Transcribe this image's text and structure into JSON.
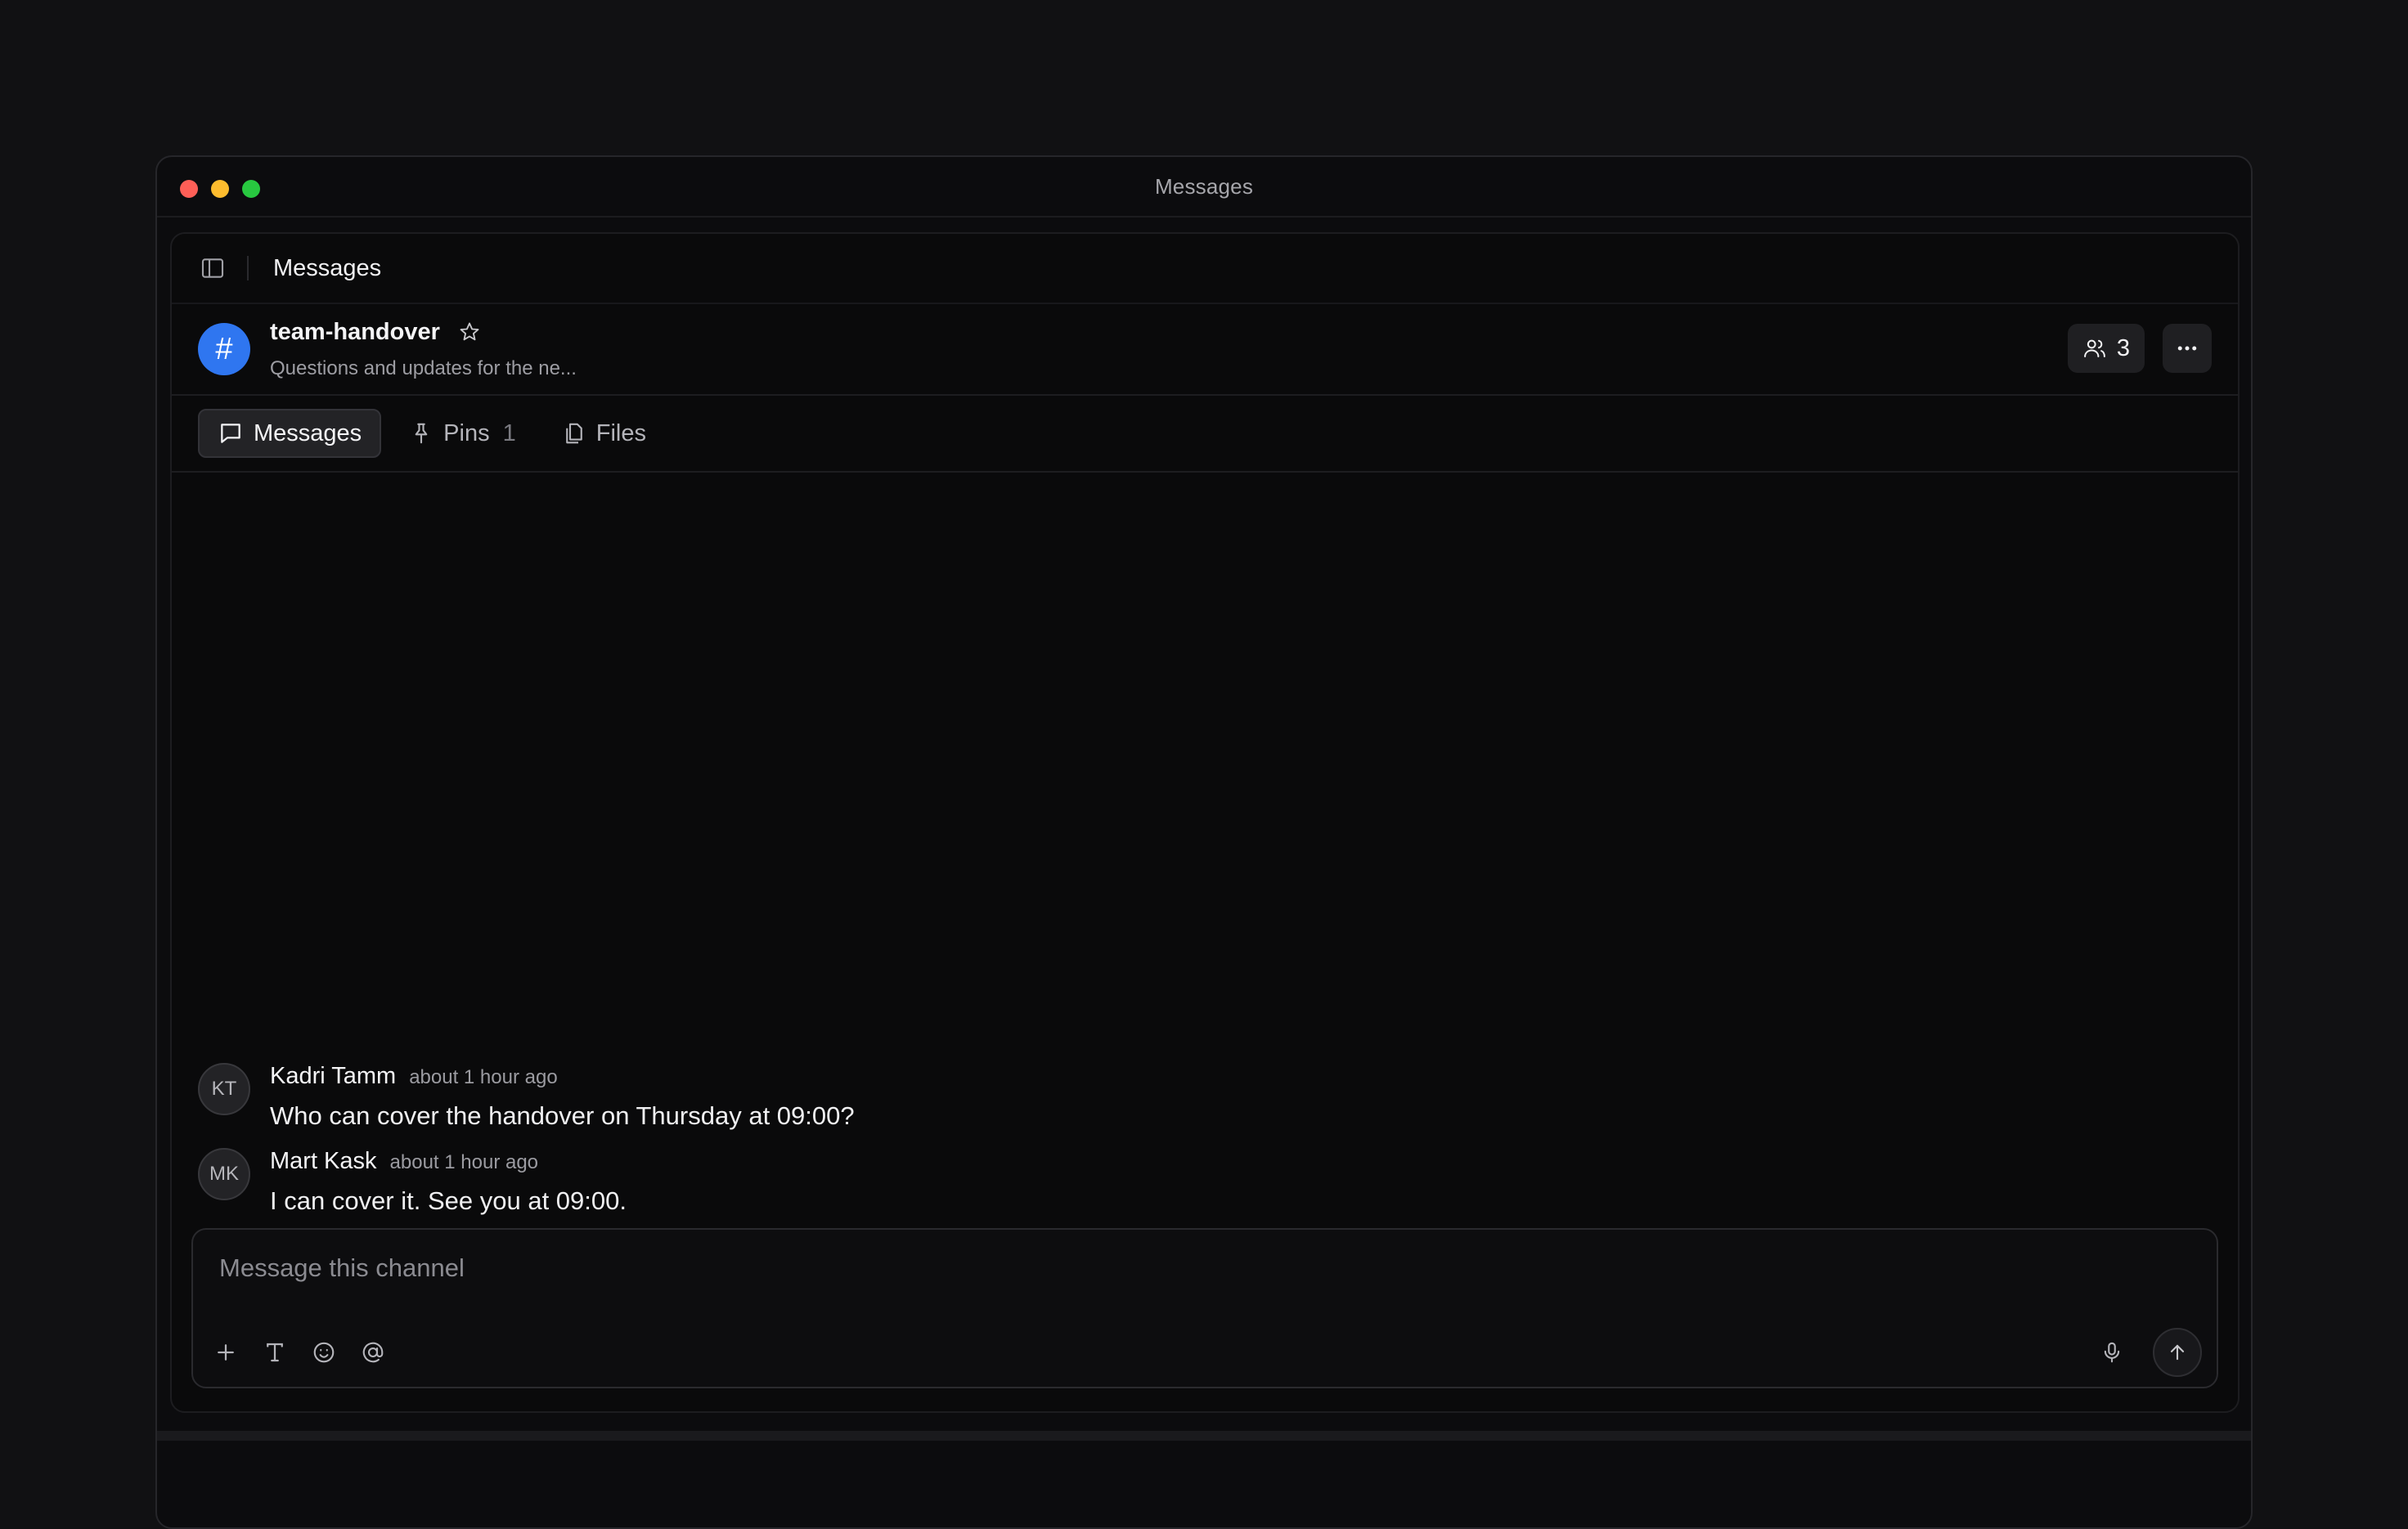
{
  "window": {
    "title": "Messages"
  },
  "topbar": {
    "title": "Messages",
    "sidebar_icon": "sidebar-toggle-icon"
  },
  "channel": {
    "symbol": "#",
    "name": "team-handover",
    "description": "Questions and updates for the ne...",
    "accent_color": "#2f76f0",
    "members_count": "3"
  },
  "tabs": [
    {
      "label": "Messages",
      "icon": "message-icon",
      "active": true
    },
    {
      "label": "Pins",
      "icon": "pin-icon",
      "count": "1"
    },
    {
      "label": "Files",
      "icon": "files-icon"
    }
  ],
  "messages": [
    {
      "initials": "KT",
      "author": "Kadri Tamm",
      "time": "about 1 hour ago",
      "text": "Who can cover the handover on Thursday at 09:00?"
    },
    {
      "initials": "MK",
      "author": "Mart Kask",
      "time": "about 1 hour ago",
      "text": "I can cover it. See you at 09:00."
    }
  ],
  "composer": {
    "placeholder": "Message this channel",
    "value": "",
    "tools": [
      "plus-icon",
      "text-format-icon",
      "emoji-icon",
      "mention-icon"
    ]
  }
}
